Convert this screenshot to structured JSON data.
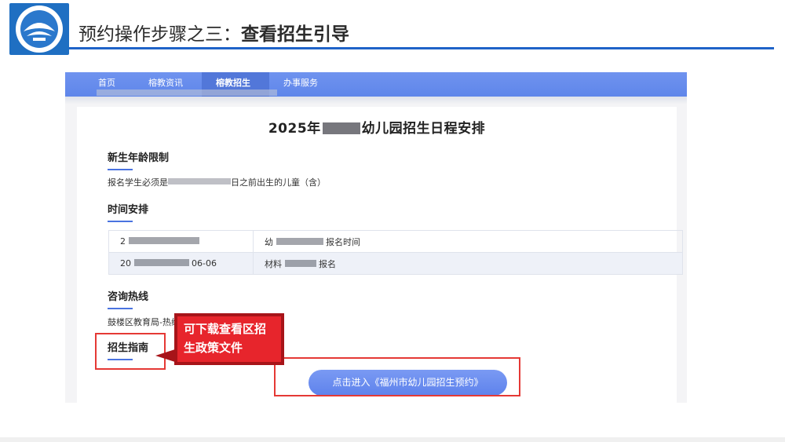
{
  "slide": {
    "title_prefix": "预约操作步骤之三：",
    "title_bold": "查看招生引导"
  },
  "nav": {
    "items": [
      {
        "label": "首页"
      },
      {
        "label": "榕教资讯"
      },
      {
        "label": "榕教招生"
      },
      {
        "label": "办事服务"
      }
    ],
    "active_index": 2
  },
  "page": {
    "title_start": "2025年",
    "title_end": "幼儿园招生日程安排",
    "age_heading": "新生年龄限制",
    "age_text_start": "报名学生必须是",
    "age_text_end": "日之前出生的儿童（含）",
    "time_heading": "时间安排",
    "schedule": [
      {
        "col1": "2",
        "col2": "幼",
        "col2_end": "报名时间"
      },
      {
        "col1": "20",
        "col1_end": "06-06",
        "col2": "材料",
        "col2_end": "报名"
      }
    ],
    "hotline_heading": "咨询热线",
    "hotline_text": "鼓楼区教育局-热线",
    "guide_heading": "招生指南",
    "cta_label": "点击进入《福州市幼儿园招生预约》"
  },
  "annotation": {
    "callout_line1": "可下载查看区招",
    "callout_line2": "生政策文件"
  },
  "colors": {
    "nav": "#5f86ea",
    "accent": "#1f63c8",
    "highlight_red": "#e53935"
  }
}
